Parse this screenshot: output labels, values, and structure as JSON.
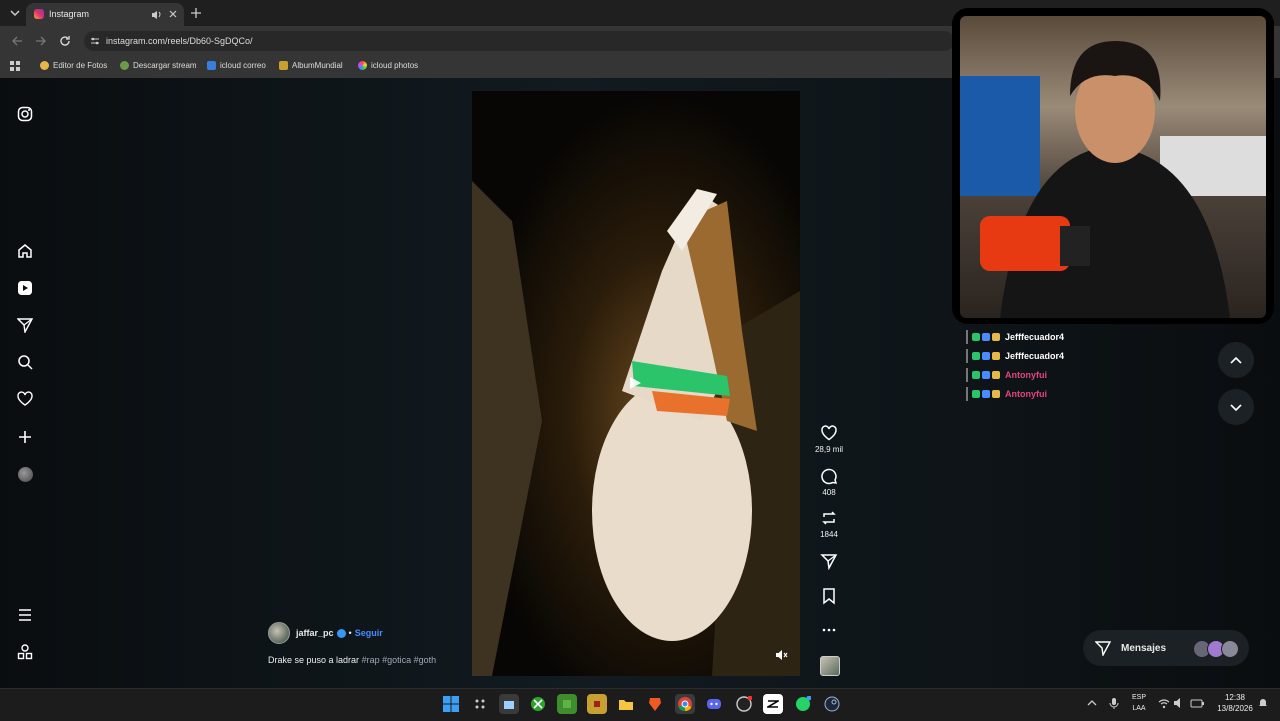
{
  "browser": {
    "tab_title": "Instagram",
    "url": "instagram.com/reels/Db60-SgDQCo/",
    "bookmarks": [
      "Editor de Fotos",
      "Descargar stream",
      "icloud correo",
      "AlbumMundial",
      "icloud photos"
    ]
  },
  "reel": {
    "likes": "28,9 mil",
    "comments": "408",
    "reposts": "1844",
    "username": "jaffar_pc",
    "follow_separator": "•",
    "follow_label": "Seguir",
    "caption_text": "Drake se puso a ladrar",
    "caption_tags": "#rap #gotica #goth"
  },
  "chat": [
    {
      "user": "Jefffecuador4",
      "color": "#ffffff"
    },
    {
      "user": "Jefffecuador4",
      "color": "#ffffff"
    },
    {
      "user": "Antonyfui",
      "color": "#e0457b"
    },
    {
      "user": "Antonyfui",
      "color": "#e0457b"
    }
  ],
  "messages": {
    "label": "Mensajes"
  },
  "taskbar": {
    "lang_line1": "ESP",
    "lang_line2": "LAA",
    "time": "12:38",
    "date": "13/8/2026"
  },
  "colors": {
    "accent_blue": "#4a8cff",
    "verified": "#3897f0",
    "chat_pink": "#e0457b"
  }
}
